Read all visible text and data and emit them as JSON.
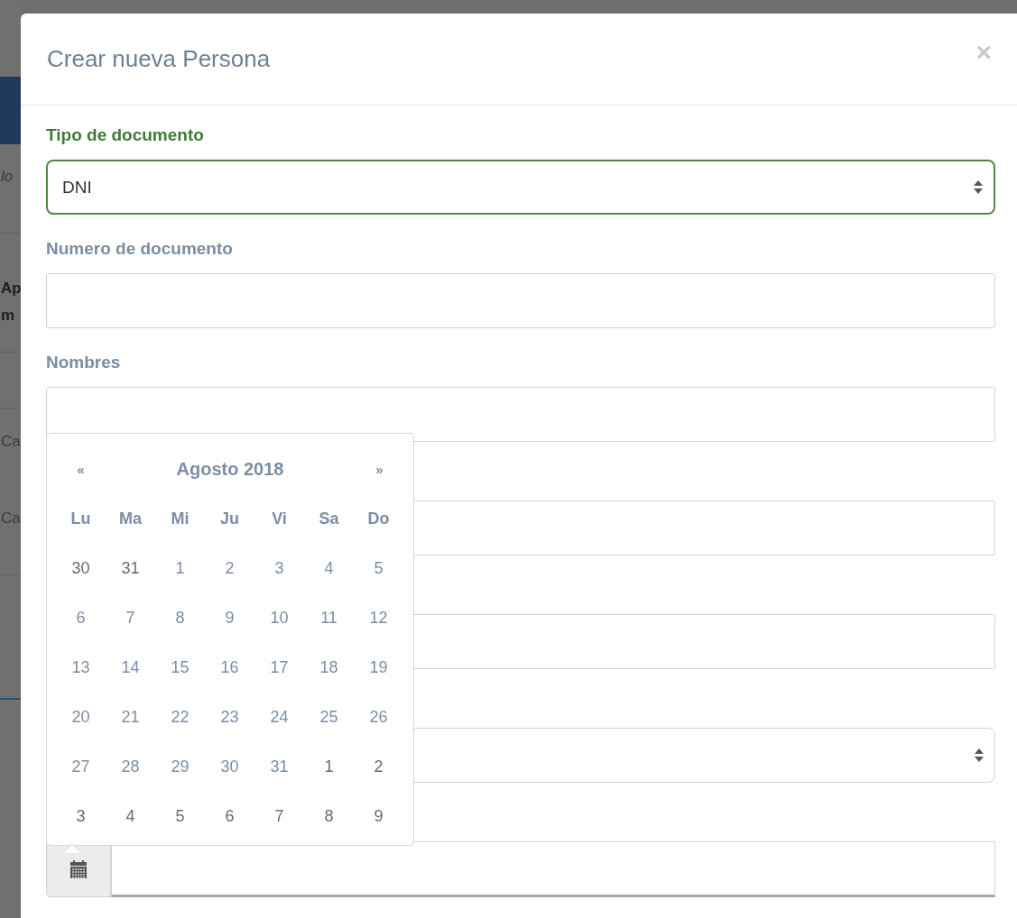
{
  "background_page": {
    "texts": [
      {
        "text": "lo",
        "kind": "italic"
      },
      {
        "text": "Ap",
        "kind": "bold"
      },
      {
        "text": "m",
        "kind": "bold"
      },
      {
        "text": "Ca",
        "kind": "plain"
      },
      {
        "text": "Ca",
        "kind": "plain"
      }
    ]
  },
  "modal": {
    "title": "Crear nueva Persona",
    "close": "×",
    "fields": [
      {
        "kind": "select",
        "label": "Tipo de documento",
        "value": "DNI",
        "valid": true
      },
      {
        "kind": "text",
        "label": "Numero de documento",
        "valid": false
      },
      {
        "kind": "text",
        "label": "Nombres",
        "valid": false
      },
      {
        "kind": "text",
        "valid": false
      },
      {
        "kind": "text",
        "valid": false
      },
      {
        "kind": "select",
        "valid": false
      },
      {
        "kind": "date",
        "valid": false
      }
    ]
  },
  "datepicker": {
    "prev": "«",
    "title": "Agosto 2018",
    "next": "»",
    "weekdays": [
      "Lu",
      "Ma",
      "Mi",
      "Ju",
      "Vi",
      "Sa",
      "Do"
    ],
    "weeks": [
      [
        {
          "day": "30",
          "other_month": true
        },
        {
          "day": "31",
          "other_month": true
        },
        {
          "day": "1",
          "other_month": false
        },
        {
          "day": "2",
          "other_month": false
        },
        {
          "day": "3",
          "other_month": false
        },
        {
          "day": "4",
          "other_month": false
        },
        {
          "day": "5",
          "other_month": false
        }
      ],
      [
        {
          "day": "6",
          "other_month": false
        },
        {
          "day": "7",
          "other_month": false
        },
        {
          "day": "8",
          "other_month": false
        },
        {
          "day": "9",
          "other_month": false
        },
        {
          "day": "10",
          "other_month": false
        },
        {
          "day": "11",
          "other_month": false
        },
        {
          "day": "12",
          "other_month": false
        }
      ],
      [
        {
          "day": "13",
          "other_month": false
        },
        {
          "day": "14",
          "other_month": false
        },
        {
          "day": "15",
          "other_month": false
        },
        {
          "day": "16",
          "other_month": false
        },
        {
          "day": "17",
          "other_month": false
        },
        {
          "day": "18",
          "other_month": false
        },
        {
          "day": "19",
          "other_month": false
        }
      ],
      [
        {
          "day": "20",
          "other_month": false
        },
        {
          "day": "21",
          "other_month": false
        },
        {
          "day": "22",
          "other_month": false
        },
        {
          "day": "23",
          "other_month": false
        },
        {
          "day": "24",
          "other_month": false
        },
        {
          "day": "25",
          "other_month": false
        },
        {
          "day": "26",
          "other_month": false
        }
      ],
      [
        {
          "day": "27",
          "other_month": false
        },
        {
          "day": "28",
          "other_month": false
        },
        {
          "day": "29",
          "other_month": false
        },
        {
          "day": "30",
          "other_month": false
        },
        {
          "day": "31",
          "other_month": false
        },
        {
          "day": "1",
          "other_month": true
        },
        {
          "day": "2",
          "other_month": true
        }
      ],
      [
        {
          "day": "3",
          "other_month": true
        },
        {
          "day": "4",
          "other_month": true
        },
        {
          "day": "5",
          "other_month": true
        },
        {
          "day": "6",
          "other_month": true
        },
        {
          "day": "7",
          "other_month": true
        },
        {
          "day": "8",
          "other_month": true
        },
        {
          "day": "9",
          "other_month": true
        }
      ]
    ]
  }
}
